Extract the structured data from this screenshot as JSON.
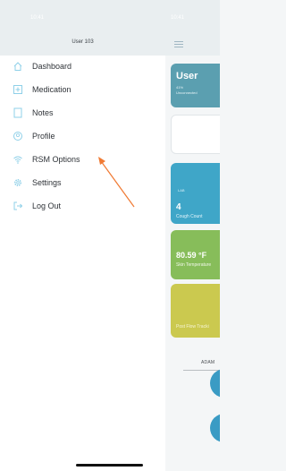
{
  "drawer": {
    "status_time": "10:41",
    "username": "User 103",
    "items": [
      {
        "label": "Dashboard",
        "icon": "home-icon"
      },
      {
        "label": "Medication",
        "icon": "medication-icon"
      },
      {
        "label": "Notes",
        "icon": "notes-icon"
      },
      {
        "label": "Profile",
        "icon": "profile-icon"
      },
      {
        "label": "RSM Options",
        "icon": "wifi-icon"
      },
      {
        "label": "Settings",
        "icon": "gear-icon"
      },
      {
        "label": "Log Out",
        "icon": "logout-icon"
      }
    ]
  },
  "main": {
    "status_time": "10:41",
    "user_card": {
      "title": "User",
      "line1": "41%",
      "line2": "Unconnected"
    },
    "cough_card": {
      "label": "LAB",
      "value": "4",
      "sub": "Cough Count"
    },
    "temp_card": {
      "value": "80.59 °F",
      "sub": "Skin Temperature"
    },
    "yellow_card": {
      "sub": "Post Flow Tracki"
    },
    "adam_label": "ADAM"
  },
  "colors": {
    "accent": "#3a9bc4",
    "icon_blue": "#8fd0e8",
    "annotation_arrow": "#f07a33"
  }
}
